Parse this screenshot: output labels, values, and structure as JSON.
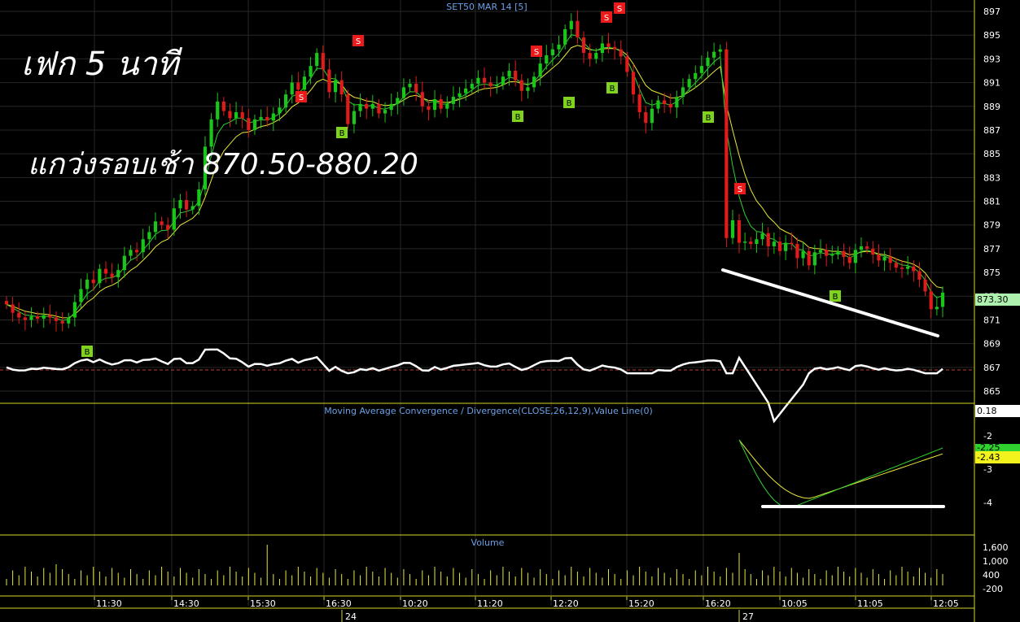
{
  "chart_title": "SET50 MAR 14   [5]",
  "annotations": {
    "line1": "เฟก 5 นาที",
    "line2": "แกว่งรอบเช้า 870.50-880.20"
  },
  "colors": {
    "background": "#000000",
    "up_candle": "#19c619",
    "down_candle": "#e01b1b",
    "fast_ma": "#2fd12f",
    "slow_ma": "#e8e83a",
    "white_line": "#ffffff",
    "grid": "#272727",
    "panel_border": "#d6d62a",
    "axis_text": "#ffffff",
    "title_text": "#6aa0e8",
    "buy_marker": "#7fd31f",
    "sell_marker": "#ec1b1b",
    "dashed_ref": "#c0403b",
    "volume_bar": "#e8e83a"
  },
  "price_panel": {
    "y_ticks": [
      "897",
      "895",
      "893",
      "891",
      "889",
      "887",
      "885",
      "883",
      "881",
      "879",
      "877",
      "875",
      "873",
      "871",
      "869",
      "867",
      "865"
    ],
    "last_price_label": "873.30"
  },
  "macd_panel": {
    "title": "Moving Average Convergence / Divergence(CLOSE,26,12,9),Value Line(0)",
    "y_ticks": [
      "-2",
      "-3",
      "-4"
    ],
    "tags": {
      "value_top": "0.18",
      "macd": "-2.25",
      "signal": "-2.43"
    }
  },
  "volume_panel": {
    "title": "Volume",
    "y_ticks": [
      "1,600",
      "1,000",
      "400",
      "-200"
    ]
  },
  "x_axis": {
    "time_ticks": [
      "11:30",
      "14:30",
      "15:30",
      "16:30",
      "10:20",
      "11:20",
      "12:20",
      "15:20",
      "16:20",
      "10:05",
      "11:05",
      "12:05"
    ],
    "day_labels": [
      "24",
      "27"
    ]
  },
  "signals": {
    "sell": "S",
    "buy": "B"
  },
  "chart_data": {
    "type": "candlestick",
    "title": "SET50 MAR 14   [5]",
    "y_range": [
      864,
      898
    ],
    "last_price": 873.3,
    "closes": [
      872.3,
      871.6,
      871.2,
      871.0,
      871.3,
      871.1,
      871.4,
      871.2,
      870.9,
      870.7,
      871.2,
      872.5,
      873.6,
      874.4,
      874.1,
      875.3,
      874.9,
      874.6,
      875.2,
      876.4,
      876.9,
      876.7,
      877.8,
      878.4,
      879.3,
      879.0,
      878.6,
      880.4,
      881.1,
      880.3,
      880.6,
      882.0,
      885.6,
      887.9,
      889.4,
      888.6,
      888.0,
      888.5,
      888.0,
      887.0,
      887.9,
      888.1,
      887.8,
      888.4,
      888.9,
      890.0,
      891.0,
      890.4,
      891.5,
      892.4,
      893.5,
      892.1,
      890.2,
      891.2,
      890.0,
      887.5,
      888.6,
      889.2,
      888.8,
      889.2,
      888.4,
      888.7,
      889.2,
      889.7,
      890.6,
      890.9,
      890.2,
      889.0,
      888.7,
      889.6,
      888.8,
      889.2,
      889.8,
      890.1,
      890.5,
      890.9,
      891.4,
      891.0,
      890.7,
      890.8,
      891.5,
      892.0,
      891.2,
      890.3,
      890.6,
      891.5,
      892.6,
      893.3,
      893.8,
      894.2,
      895.5,
      896.2,
      894.8,
      893.5,
      893.0,
      893.5,
      894.3,
      894.0,
      893.8,
      893.2,
      891.9,
      890.0,
      888.5,
      887.6,
      888.8,
      889.5,
      889.2,
      888.9,
      889.8,
      890.6,
      891.3,
      891.8,
      892.4,
      893.1,
      893.6,
      893.8,
      877.9,
      879.4,
      877.5,
      877.6,
      877.4,
      877.8,
      878.3,
      877.2,
      877.6,
      876.8,
      877.5,
      877.4,
      876.2,
      876.8,
      875.6,
      876.7,
      876.9,
      876.4,
      876.5,
      876.8,
      876.3,
      875.8,
      876.9,
      877.2,
      877.0,
      876.5,
      876.0,
      876.3,
      875.8,
      875.4,
      875.3,
      875.5,
      875.1,
      874.4,
      873.4,
      871.9,
      872.1,
      873.3
    ],
    "macd_last": -2.25,
    "signal_last": -2.43,
    "buy_signals": [
      "10:05"
    ],
    "sell_signals": []
  }
}
